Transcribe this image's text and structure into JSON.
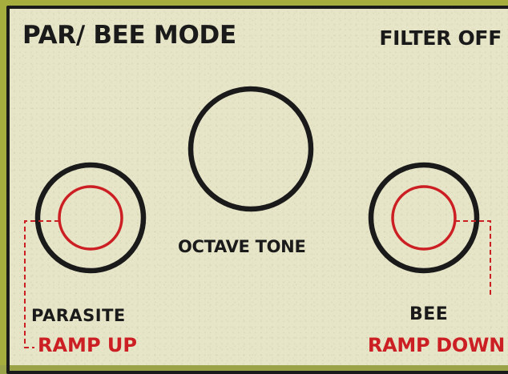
{
  "panel": {
    "mode_label": "PAR/ BEE MODE",
    "filter_label": "FILTER OFF",
    "octave_label": "OCTAVE TONE",
    "left": {
      "name": "PARASITE",
      "ramp": "RAMP UP"
    },
    "right": {
      "name": "BEE",
      "ramp": "RAMP DOWN"
    }
  },
  "colors": {
    "panel_bg": "#e7e5c8",
    "frame_green": "#a4ad3d",
    "ink": "#1a1a1a",
    "accent_red": "#cc1f24"
  }
}
